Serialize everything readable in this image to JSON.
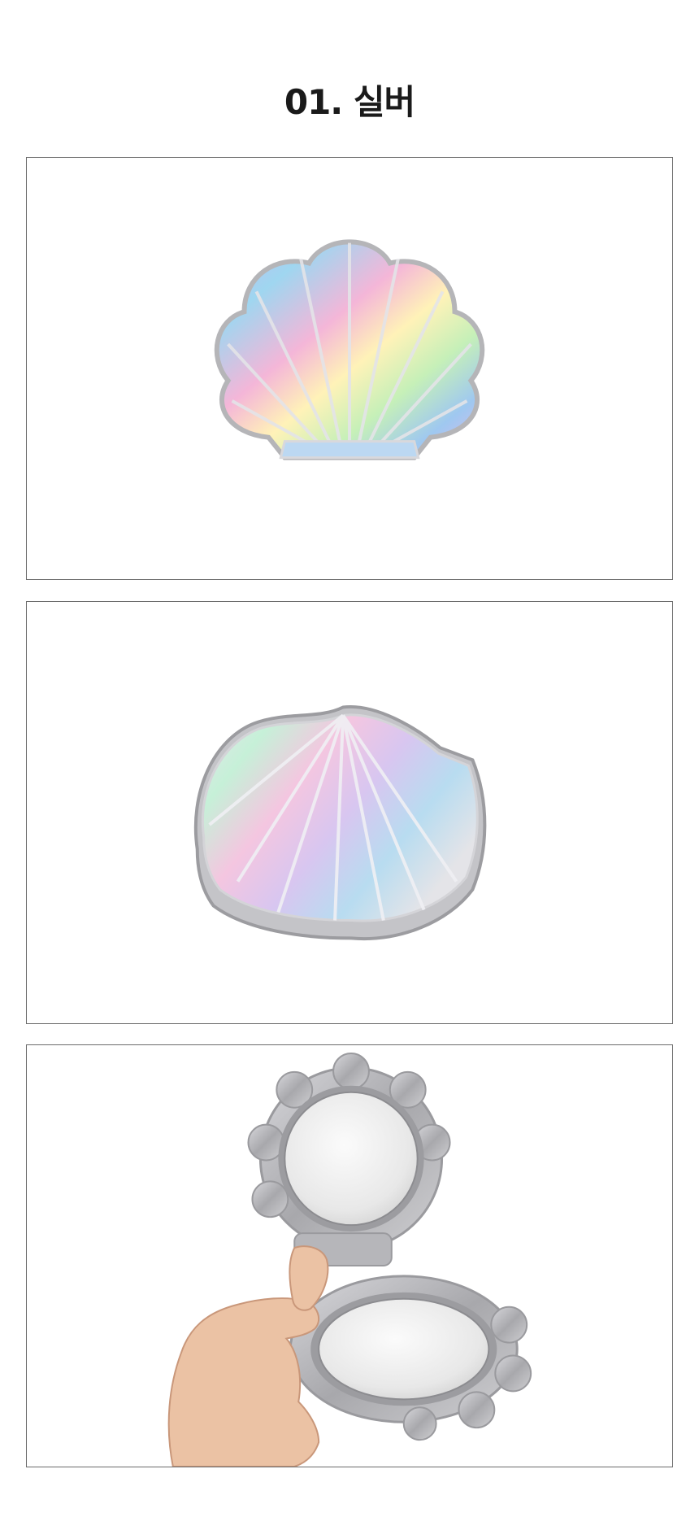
{
  "title": "01. 실버",
  "product_images": [
    {
      "name": "holographic-shell-mirror-front"
    },
    {
      "name": "holographic-shell-mirror-angled"
    },
    {
      "name": "shell-mirror-open-in-hand"
    }
  ],
  "colors": {
    "frame_border": "#6b6b6b",
    "title_text": "#1a1a1a",
    "silver": "#c9c9cc",
    "holo_pink": "#f4b6d8",
    "holo_blue": "#9fd6f0",
    "holo_green": "#c6f0b8"
  }
}
